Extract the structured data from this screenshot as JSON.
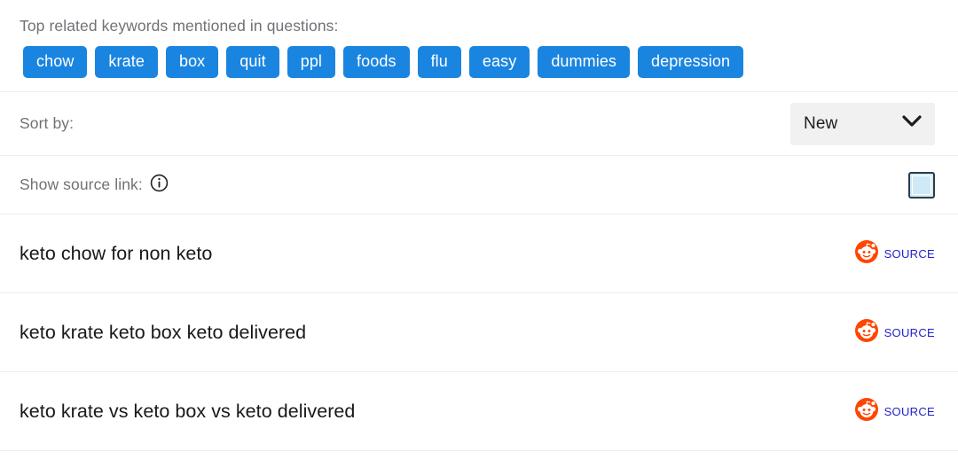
{
  "keywords": {
    "title": "Top related keywords mentioned in questions:",
    "chips": [
      {
        "label": "chow"
      },
      {
        "label": "krate"
      },
      {
        "label": "box"
      },
      {
        "label": "quit"
      },
      {
        "label": "ppl"
      },
      {
        "label": "foods"
      },
      {
        "label": "flu"
      },
      {
        "label": "easy"
      },
      {
        "label": "dummies"
      },
      {
        "label": "depression"
      }
    ]
  },
  "controls": {
    "sort": {
      "label": "Sort by:",
      "selected": "New",
      "chevron_icon": "chevron-down-icon"
    },
    "source_link": {
      "label": "Show source link:",
      "info_icon": "info-icon",
      "checkbox_checked": false
    }
  },
  "results": [
    {
      "text": "keto chow for non keto",
      "source_label": "Source",
      "source_icon": "reddit-icon"
    },
    {
      "text": "keto krate keto box keto delivered",
      "source_label": "Source",
      "source_icon": "reddit-icon"
    },
    {
      "text": "keto krate vs keto box vs keto delivered",
      "source_label": "Source",
      "source_icon": "reddit-icon"
    }
  ],
  "colors": {
    "chip_blue": "#1a85e0",
    "source_blue": "#2222cc",
    "reddit_orange": "#ff4500",
    "label_gray": "#6f7276",
    "divider": "#ededee",
    "checkbox_fill": "#cfeaf7"
  }
}
